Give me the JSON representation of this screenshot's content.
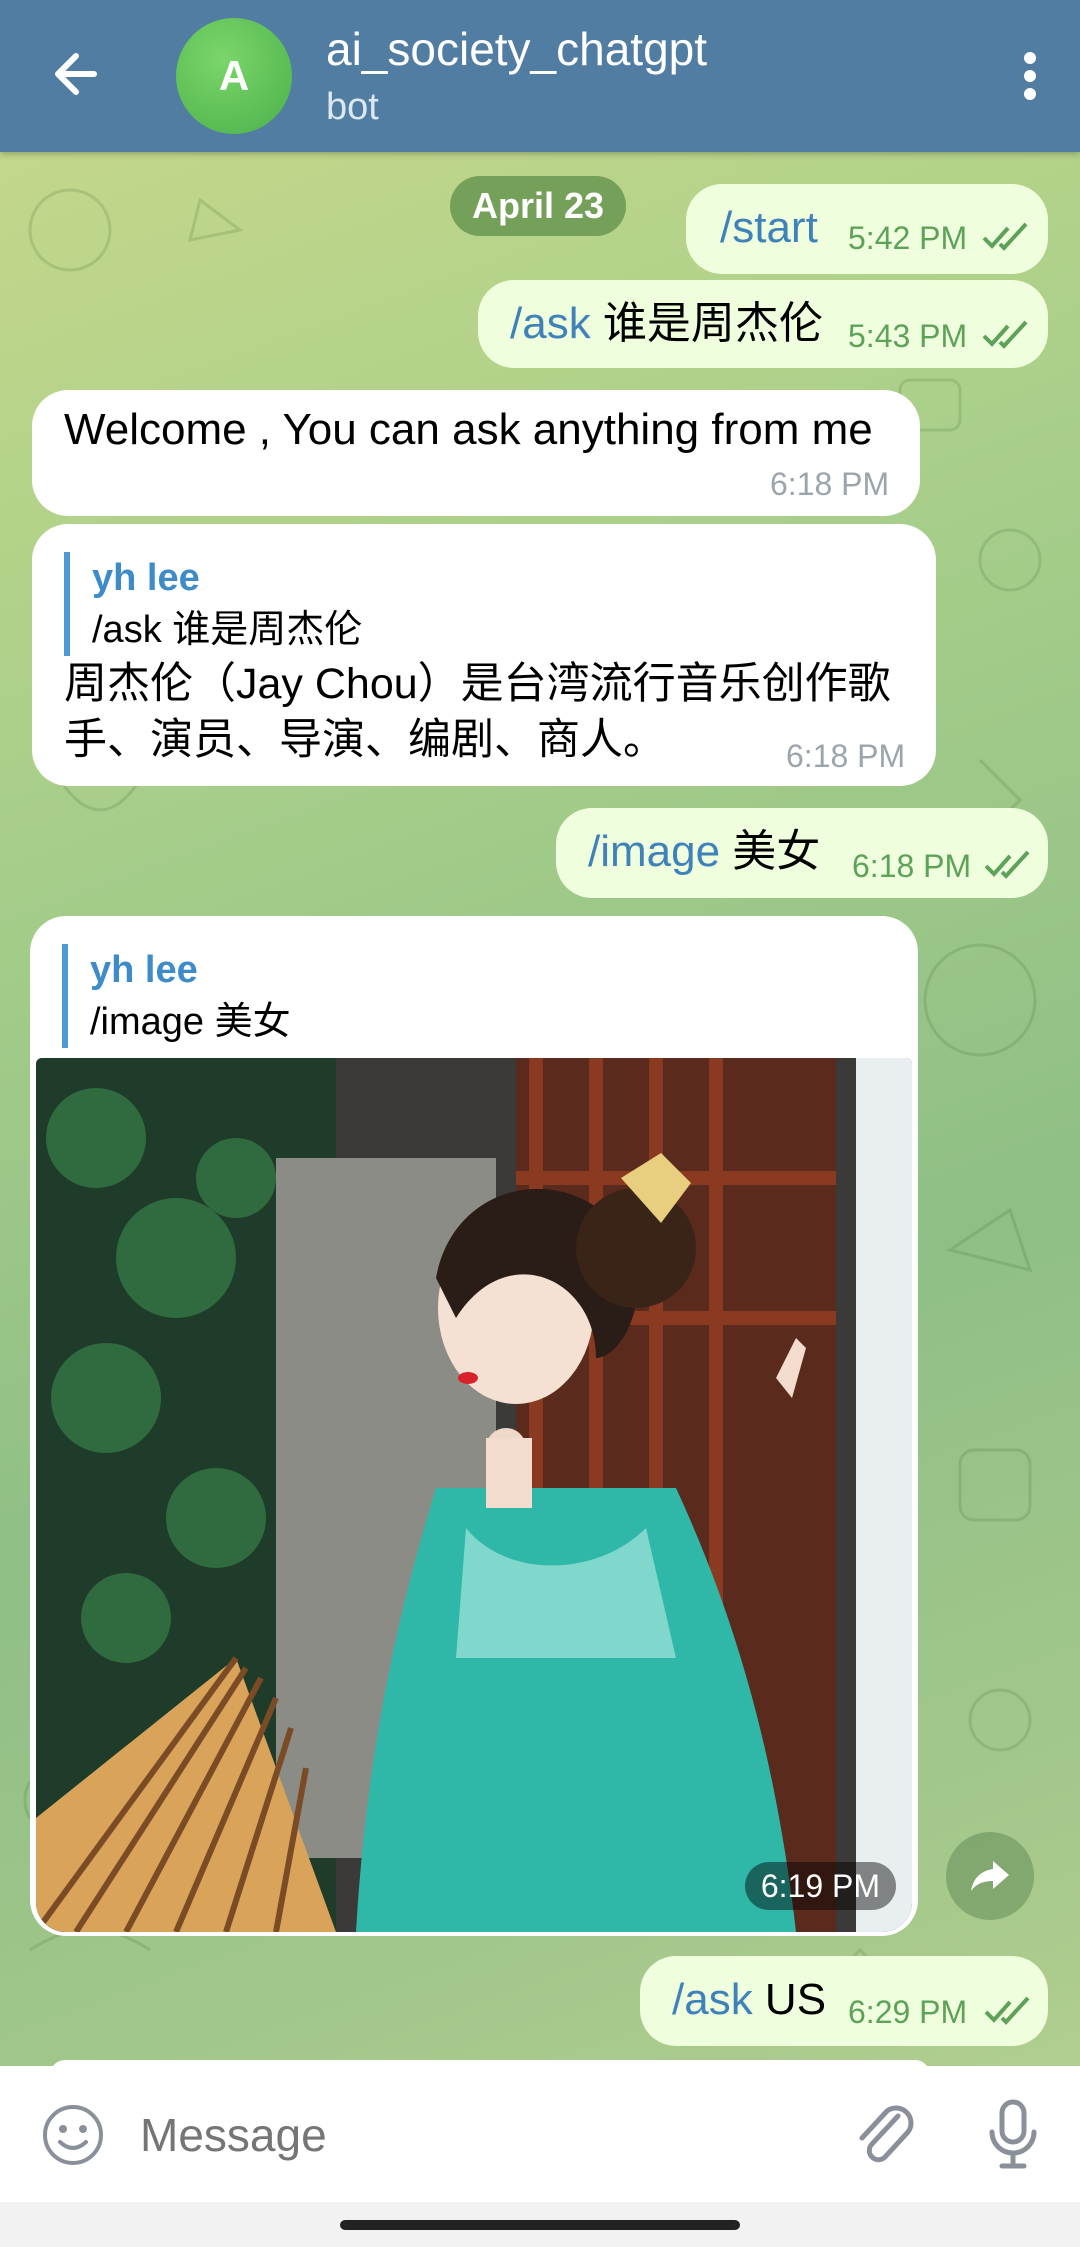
{
  "header": {
    "title": "ai_society_chatgpt",
    "subtitle": "bot",
    "avatar_letter": "A"
  },
  "date_separator": "April 23",
  "messages": [
    {
      "dir": "out",
      "command": "/start",
      "text": "",
      "time": "5:42 PM",
      "read": true
    },
    {
      "dir": "out",
      "command": "/ask",
      "text": " 谁是周杰伦",
      "time": "5:43 PM",
      "read": true
    },
    {
      "dir": "in",
      "text": "Welcome , You can ask anything from me",
      "time": "6:18 PM"
    },
    {
      "dir": "in",
      "reply_name": "yh lee",
      "reply_text": "/ask 谁是周杰伦",
      "text_line1": "周杰伦（Jay Chou）是台湾流行音乐创作歌",
      "text_line2": "手、演员、导演、编剧、商人。",
      "time": "6:18 PM"
    },
    {
      "dir": "out",
      "command": "/image",
      "text": " 美女",
      "time": "6:18 PM",
      "read": true
    },
    {
      "dir": "in",
      "reply_name": "yh lee",
      "reply_text": "/image 美女",
      "type": "photo",
      "time": "6:19 PM"
    },
    {
      "dir": "out",
      "command": "/ask",
      "text": " US",
      "time": "6:29 PM",
      "read": true
    }
  ],
  "input": {
    "placeholder": "Message"
  },
  "colors": {
    "header": "#517da2",
    "outgoing": "#effedd",
    "incoming": "#ffffff",
    "accent": "#3f82b9"
  },
  "icons": [
    "back-arrow-icon",
    "more-vert-icon",
    "double-check-icon",
    "share-icon",
    "emoji-icon",
    "paperclip-icon",
    "microphone-icon"
  ]
}
